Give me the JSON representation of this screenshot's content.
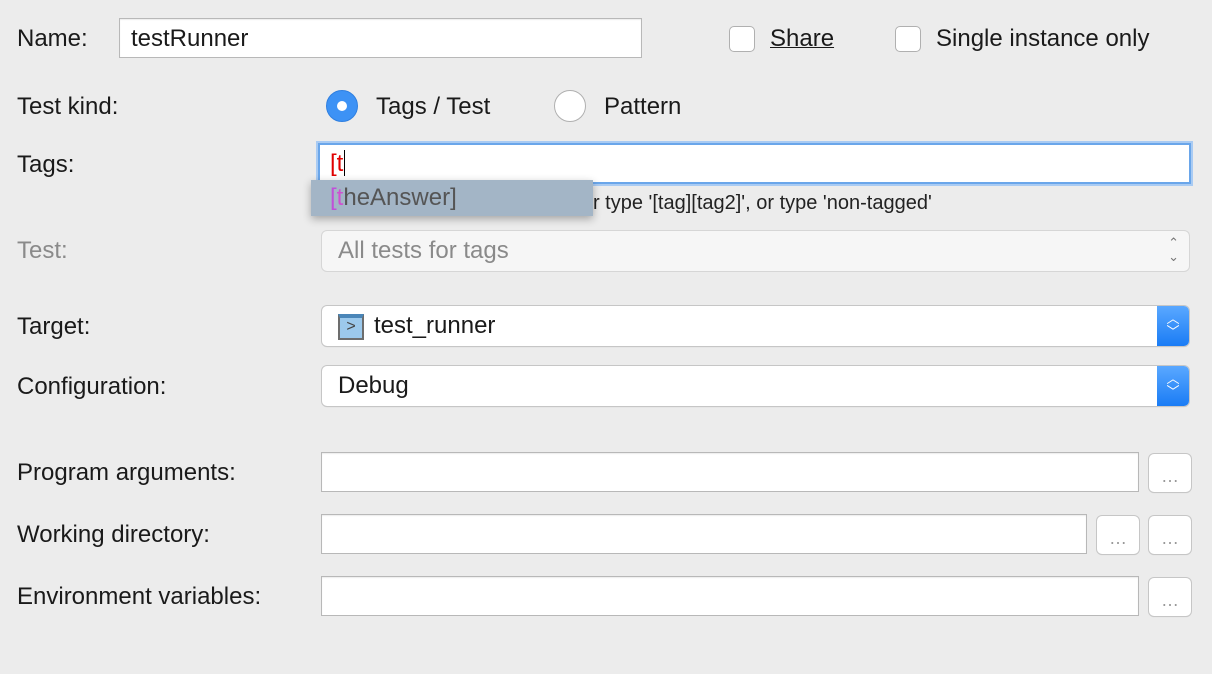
{
  "name": {
    "label": "Name:",
    "value": "testRunner"
  },
  "share": {
    "label": "Share",
    "checked": false
  },
  "single_instance": {
    "label": "Single instance only",
    "checked": false
  },
  "test_kind": {
    "label": "Test kind:",
    "options": [
      {
        "label": "Tags / Test",
        "selected": true
      },
      {
        "label": "Pattern",
        "selected": false
      }
    ]
  },
  "tags": {
    "label": "Tags:",
    "value_bracket": "[",
    "value_rest": "t",
    "hint": "or all tags, or type '[tag][tag2]', or type 'non-tagged'"
  },
  "autocomplete": {
    "bracket": "[",
    "match": "t",
    "rest": "heAnswer]"
  },
  "test": {
    "label": "Test:",
    "value": "All tests for tags"
  },
  "target": {
    "label": "Target:",
    "value": "test_runner",
    "icon": "terminal-icon"
  },
  "configuration": {
    "label": "Configuration:",
    "value": "Debug"
  },
  "program_arguments": {
    "label": "Program arguments:",
    "value": "",
    "browse": "…"
  },
  "working_directory": {
    "label": "Working directory:",
    "value": "",
    "browse": "…",
    "macro": "…"
  },
  "environment_variables": {
    "label": "Environment variables:",
    "value": "",
    "browse": "…"
  },
  "colors": {
    "accent": "#3d92f5",
    "error_red": "#e00000",
    "match_magenta": "#d050d0"
  }
}
